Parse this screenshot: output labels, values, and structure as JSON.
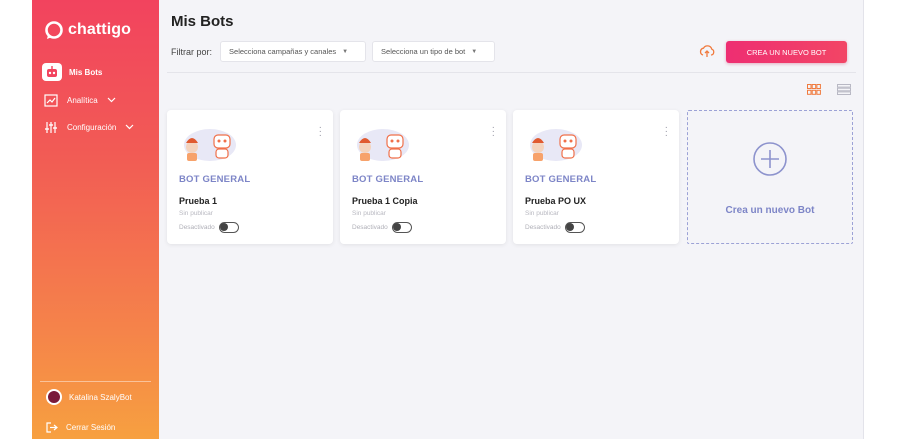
{
  "sidebar": {
    "brand": "chattigo",
    "items": [
      {
        "label": "Mis Bots",
        "icon": "robot-icon",
        "active": true
      },
      {
        "label": "Analítica",
        "icon": "chart-icon",
        "active": false
      },
      {
        "label": "Configuración",
        "icon": "settings-sliders-icon",
        "active": false
      }
    ],
    "user": {
      "name": "Katalina SzalyBot"
    },
    "logout_label": "Cerrar Sesión"
  },
  "header": {
    "title": "Mis Bots",
    "filter_label": "Filtrar por:",
    "filter_campaigns": {
      "value": "Selecciona campañas y canales"
    },
    "filter_type": {
      "value": "Selecciona un tipo de bot"
    },
    "create_button": "CREA UN NUEVO BOT"
  },
  "cards": [
    {
      "type": "BOT GENERAL",
      "name": "Prueba 1",
      "publish_status": "Sin publicar",
      "state": "Desactivado",
      "enabled": false
    },
    {
      "type": "BOT GENERAL",
      "name": "Prueba 1 Copia",
      "publish_status": "Sin publicar",
      "state": "Desactivado",
      "enabled": false
    },
    {
      "type": "BOT GENERAL",
      "name": "Prueba PO UX",
      "publish_status": "Sin publicar",
      "state": "Desactivado",
      "enabled": false
    }
  ],
  "new_card": {
    "label": "Crea un nuevo Bot"
  },
  "colors": {
    "brand_pink": "#ee2e72",
    "accent_lavender": "#7d85c7",
    "sidebar_top": "#f2435e",
    "sidebar_bottom": "#f7a040"
  }
}
